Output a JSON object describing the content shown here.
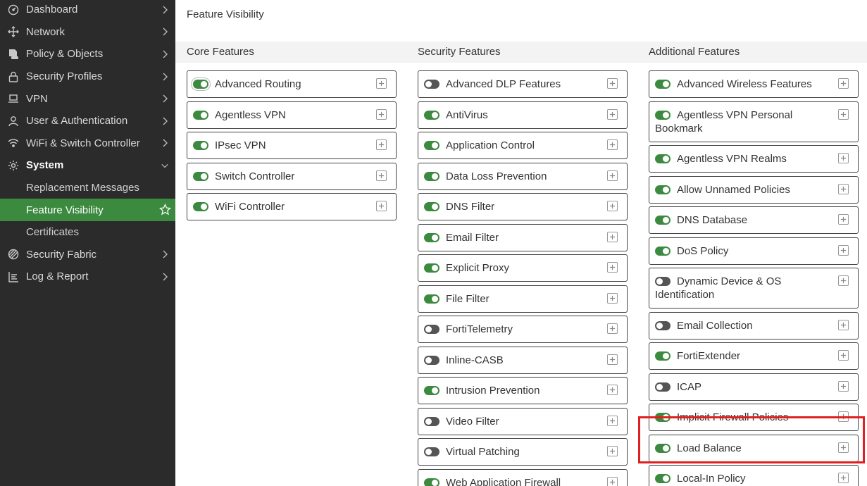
{
  "sidebar": {
    "items": [
      {
        "label": "Dashboard",
        "icon": "dashboard-icon"
      },
      {
        "label": "Network",
        "icon": "network-icon"
      },
      {
        "label": "Policy & Objects",
        "icon": "policy-icon"
      },
      {
        "label": "Security Profiles",
        "icon": "lock-icon"
      },
      {
        "label": "VPN",
        "icon": "laptop-icon"
      },
      {
        "label": "User & Authentication",
        "icon": "user-icon"
      },
      {
        "label": "WiFi & Switch Controller",
        "icon": "wifi-icon"
      },
      {
        "label": "System",
        "icon": "gear-icon"
      }
    ],
    "system_sub": [
      {
        "label": "Replacement Messages"
      },
      {
        "label": "Feature Visibility"
      },
      {
        "label": "Certificates"
      }
    ],
    "bottom_items": [
      {
        "label": "Security Fabric",
        "icon": "fabric-icon"
      },
      {
        "label": "Log & Report",
        "icon": "log-icon"
      }
    ]
  },
  "page": {
    "title": "Feature Visibility"
  },
  "columns": [
    {
      "title": "Core Features",
      "features": [
        {
          "label": "Advanced Routing",
          "enabled": true
        },
        {
          "label": "Agentless VPN",
          "enabled": true
        },
        {
          "label": "IPsec VPN",
          "enabled": true
        },
        {
          "label": "Switch Controller",
          "enabled": true
        },
        {
          "label": "WiFi Controller",
          "enabled": true
        }
      ]
    },
    {
      "title": "Security Features",
      "features": [
        {
          "label": "Advanced DLP Features",
          "enabled": false
        },
        {
          "label": "AntiVirus",
          "enabled": true
        },
        {
          "label": "Application Control",
          "enabled": true
        },
        {
          "label": "Data Loss Prevention",
          "enabled": true
        },
        {
          "label": "DNS Filter",
          "enabled": true
        },
        {
          "label": "Email Filter",
          "enabled": true
        },
        {
          "label": "Explicit Proxy",
          "enabled": true
        },
        {
          "label": "File Filter",
          "enabled": true
        },
        {
          "label": "FortiTelemetry",
          "enabled": false
        },
        {
          "label": "Inline-CASB",
          "enabled": false
        },
        {
          "label": "Intrusion Prevention",
          "enabled": true
        },
        {
          "label": "Video Filter",
          "enabled": false
        },
        {
          "label": "Virtual Patching",
          "enabled": false
        },
        {
          "label": "Web Application Firewall",
          "enabled": true
        }
      ]
    },
    {
      "title": "Additional Features",
      "features": [
        {
          "label": "Advanced Wireless Features",
          "enabled": true
        },
        {
          "label": "Agentless VPN Personal Bookmark",
          "enabled": true
        },
        {
          "label": "Agentless VPN Realms",
          "enabled": true
        },
        {
          "label": "Allow Unnamed Policies",
          "enabled": true
        },
        {
          "label": "DNS Database",
          "enabled": true
        },
        {
          "label": "DoS Policy",
          "enabled": true
        },
        {
          "label": "Dynamic Device & OS Identification",
          "enabled": false
        },
        {
          "label": "Email Collection",
          "enabled": false
        },
        {
          "label": "FortiExtender",
          "enabled": true
        },
        {
          "label": "ICAP",
          "enabled": false
        },
        {
          "label": "Implicit Firewall Policies",
          "enabled": true
        },
        {
          "label": "Load Balance",
          "enabled": true
        },
        {
          "label": "Local-In Policy",
          "enabled": true
        }
      ]
    }
  ],
  "colors": {
    "sidebar_bg": "#2b2b2b",
    "active_green": "#3c8a3f",
    "highlight_red": "#e02020"
  }
}
